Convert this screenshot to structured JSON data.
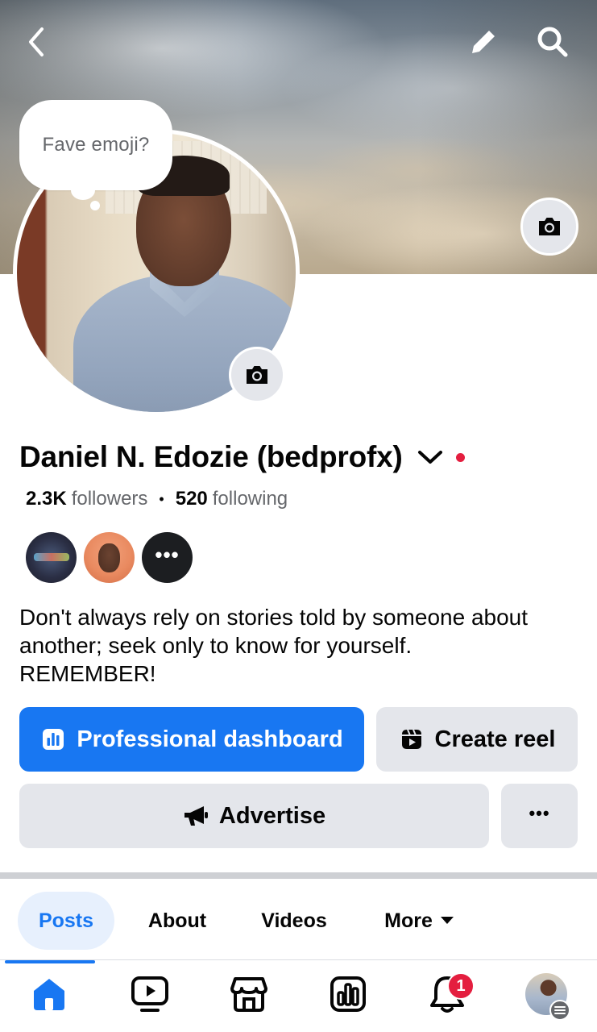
{
  "header": {
    "back_icon": "chevron-left-icon",
    "edit_icon": "pencil-icon",
    "search_icon": "search-icon"
  },
  "cover": {
    "camera_icon": "camera-icon"
  },
  "avatar": {
    "camera_icon": "camera-icon",
    "note": "Fave emoji?"
  },
  "profile": {
    "name": "Daniel N. Edozie (bedprofx)",
    "followers_count": "2.3K",
    "followers_label": "followers",
    "following_count": "520",
    "following_label": "following",
    "status_dot_color": "#e41e3f"
  },
  "highlights": [
    {
      "icon": "highlight-thumbnail"
    },
    {
      "icon": "highlight-thumbnail"
    },
    {
      "label": "•••"
    }
  ],
  "bio": {
    "lines": [
      "Don't always rely on stories told by someone about",
      "another; seek only to know for yourself.",
      "REMEMBER!"
    ]
  },
  "actions": {
    "dashboard_label": "Professional dashboard",
    "reel_label": "Create reel",
    "advertise_label": "Advertise",
    "more_label": "•••"
  },
  "tabs": [
    {
      "label": "Posts",
      "active": true
    },
    {
      "label": "About"
    },
    {
      "label": "Videos"
    },
    {
      "label": "More"
    }
  ],
  "bottom_nav": {
    "items": [
      "home-icon",
      "video-icon",
      "marketplace-icon",
      "dashboard-icon",
      "bell-icon",
      "profile-avatar"
    ],
    "notifications_badge": "1"
  },
  "colors": {
    "accent": "#1877f2",
    "badge": "#e41e3f",
    "secondary_button": "#e4e6eb"
  }
}
